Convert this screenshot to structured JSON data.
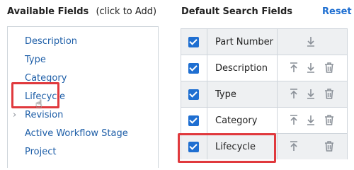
{
  "left": {
    "title": "Available Fields",
    "hint": "(click to Add)",
    "items": [
      {
        "label": "Description"
      },
      {
        "label": "Type"
      },
      {
        "label": "Category"
      },
      {
        "label": "Lifecycle"
      },
      {
        "label": "Revision",
        "expandable": true
      },
      {
        "label": "Active Workflow Stage"
      },
      {
        "label": "Project"
      }
    ]
  },
  "right": {
    "title": "Default Search Fields",
    "reset_label": "Reset",
    "rows": [
      {
        "label": "Part Number",
        "checked": true
      },
      {
        "label": "Description",
        "checked": true
      },
      {
        "label": "Type",
        "checked": true
      },
      {
        "label": "Category",
        "checked": true
      },
      {
        "label": "Lifecycle",
        "checked": true
      }
    ]
  },
  "icons": {
    "move_top": "move-to-top-icon",
    "move_down": "move-down-icon",
    "delete": "trash-icon",
    "expander": "chevron-right-icon",
    "cursor": "hand-cursor-icon"
  },
  "colors": {
    "link": "#1f5fa8",
    "accent": "#1f6fd1",
    "highlight": "#e0393d",
    "icon": "#8a9098"
  }
}
